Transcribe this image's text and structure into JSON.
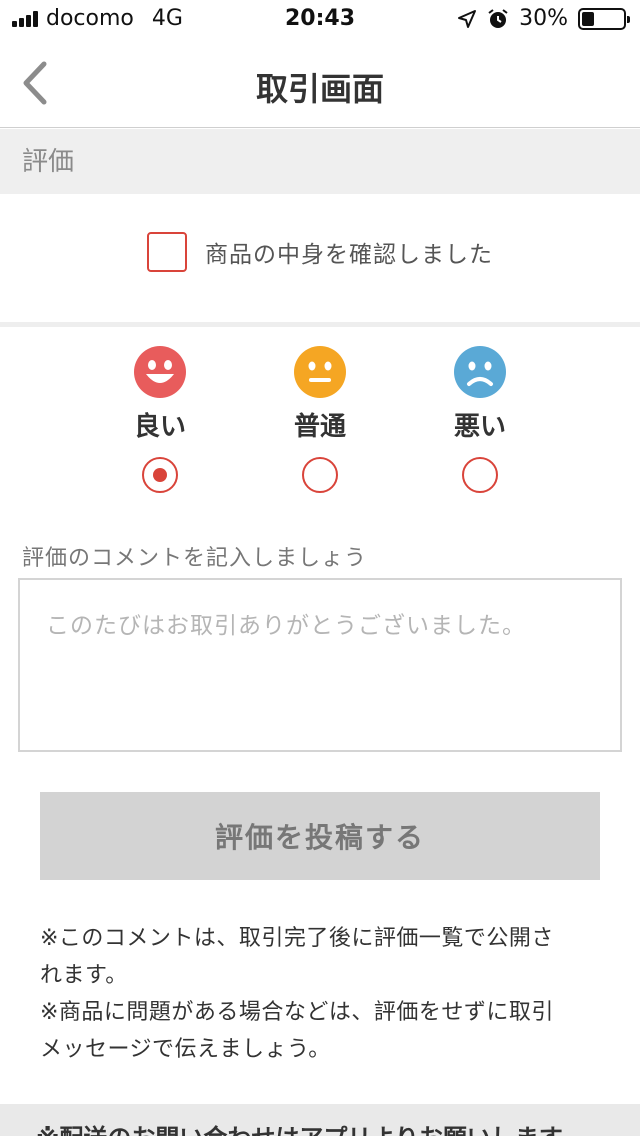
{
  "status_bar": {
    "carrier": "docomo",
    "network": "4G",
    "time": "20:43",
    "battery": "30%",
    "battery_level": 0.3,
    "icons": [
      "signal-icon",
      "location-arrow-icon",
      "alarm-clock-icon",
      "battery-icon"
    ]
  },
  "nav": {
    "back_icon": "chevron-left-icon",
    "title": "取引画面"
  },
  "section": {
    "title": "評価"
  },
  "confirm": {
    "label": "商品の中身を確認しました",
    "checked": false
  },
  "rating": {
    "options": [
      {
        "label": "良い",
        "icon": "happy-face-icon",
        "color": "#e85c5c",
        "selected": true
      },
      {
        "label": "普通",
        "icon": "neutral-face-icon",
        "color": "#f5a623",
        "selected": false
      },
      {
        "label": "悪い",
        "icon": "sad-face-icon",
        "color": "#5aa9d6",
        "selected": false
      }
    ]
  },
  "comment": {
    "label": "評価のコメントを記入しましょう",
    "placeholder": "このたびはお取引ありがとうございました。"
  },
  "submit": {
    "label": "評価を投稿する"
  },
  "notes": [
    "※このコメントは、取引完了後に評価一覧で公開さ",
    "れます。",
    "※商品に問題がある場合などは、評価をせずに取引",
    "メッセージで伝えましょう。"
  ],
  "footer": {
    "text": "※配送のお問い合わせはアプリよりお願いします"
  },
  "colors": {
    "accent": "#d9443a",
    "section_bg": "#efefef",
    "button_disabled": "#d3d3d3"
  }
}
